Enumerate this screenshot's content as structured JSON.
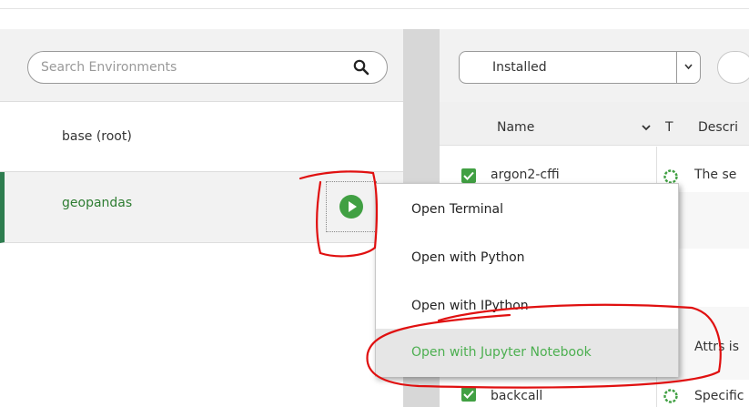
{
  "environments": {
    "search_placeholder": "Search Environments",
    "items": [
      {
        "label": "base (root)",
        "active": false
      },
      {
        "label": "geopandas",
        "active": true
      }
    ]
  },
  "packages": {
    "filter_value": "Installed",
    "columns": {
      "name": "Name",
      "type": "T",
      "description": "Descri"
    },
    "rows": [
      {
        "name": "argon2-cffi",
        "description": "The se"
      },
      {
        "name": "",
        "description": ""
      },
      {
        "name": "",
        "description": ""
      },
      {
        "name": "",
        "description": "Attrs is"
      },
      {
        "name": "backcall",
        "description": "Specific"
      }
    ]
  },
  "context_menu": {
    "items": [
      {
        "label": "Open Terminal",
        "highlighted": false
      },
      {
        "label": "Open with Python",
        "highlighted": false
      },
      {
        "label": "Open with IPython",
        "highlighted": false
      },
      {
        "label": "Open with Jupyter Notebook",
        "highlighted": true
      }
    ]
  },
  "colors": {
    "accent_green": "#41a043",
    "active_env_text": "#2e7d32",
    "highlight_text": "#4caf50",
    "annotation_red": "#e01010"
  },
  "icons": {
    "search": "magnifier-icon",
    "play": "play-circle-icon",
    "installed": "checkbox-checked-icon",
    "status": "ring-icon"
  }
}
